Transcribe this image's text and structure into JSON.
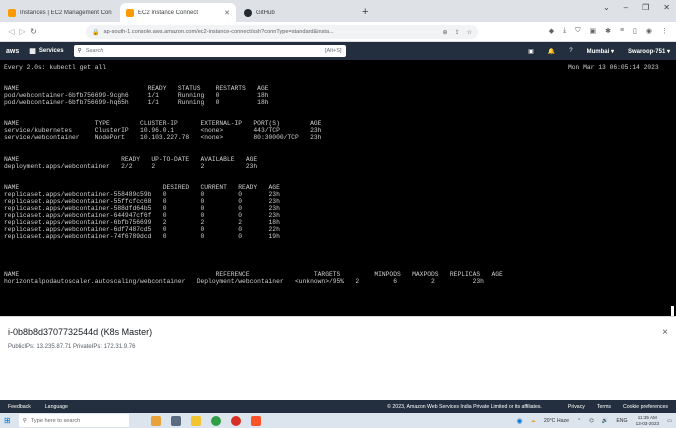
{
  "colors": {
    "aws_nav": "#232f3e",
    "terminal_bg": "#000000",
    "terminal_fg": "#d0d0d0",
    "ec2_favicon": "#ff9900",
    "edge_accent": "#0078d4"
  },
  "browser": {
    "tabs": [
      {
        "label": "Instances | EC2 Management Console",
        "icon": "aws-favicon",
        "active": false
      },
      {
        "label": "EC2 Instance Connect",
        "icon": "aws-favicon",
        "active": true
      },
      {
        "label": "GitHub",
        "icon": "github-icon",
        "active": false
      }
    ],
    "new_tab": "+",
    "url": "ap-south-1.console.aws.amazon.com/ec2-instance-connect/ssh?connType=standard&insta..."
  },
  "aws": {
    "logo": "aws",
    "services": "Services",
    "search_placeholder": "Search",
    "search_hint": "[Alt+S]",
    "region": "Mumbai ▾",
    "user": "Swaroop-751 ▾"
  },
  "terminal": {
    "lines": [
      "Every 2.0s: kubectl get all",
      "Mon Mar 13 06:05:14 2023",
      "NAME                                  READY   STATUS    RESTARTS   AGE",
      "pod/webcontainer-6bfb756699-9cgh6     1/1     Running   0          18h",
      "pod/webcontainer-6bfb756699-hq65h     1/1     Running   0          18h",
      "NAME                    TYPE        CLUSTER-IP      EXTERNAL-IP   PORT(S)        AGE",
      "service/kubernetes      ClusterIP   10.96.0.1       <none>        443/TCP        23h",
      "service/webcontainer    NodePort    10.103.227.78   <none>        80:30000/TCP   23h",
      "NAME                           READY   UP-TO-DATE   AVAILABLE   AGE",
      "deployment.apps/webcontainer   2/2     2            2           23h",
      "NAME                                      DESIRED   CURRENT   READY   AGE",
      "replicaset.apps/webcontainer-558489c59b   0         0         0       23h",
      "replicaset.apps/webcontainer-55ffcfcc68   0         0         0       23h",
      "replicaset.apps/webcontainer-588dfd64b5   0         0         0       23h",
      "replicaset.apps/webcontainer-644947cf6f   0         0         0       23h",
      "replicaset.apps/webcontainer-6bfb756699   2         2         2       18h",
      "replicaset.apps/webcontainer-6df7487cd5   0         0         0       22h",
      "replicaset.apps/webcontainer-74f6789dcd   0         0         0       19h",
      "NAME                                                    REFERENCE                 TARGETS         MINPODS   MAXPODS   REPLICAS   AGE",
      "horizontalpodautoscaler.autoscaling/webcontainer   Deployment/webcontainer   <unknown>/95%   2         6         2          23h"
    ]
  },
  "instance": {
    "title": "i-0b8b8d3707732544d (K8s Master)",
    "ips": "PublicIPs: 13.235.87.71   PrivateIPs: 172.31.9.76",
    "close": "×"
  },
  "footer": {
    "feedback": "Feedback",
    "language": "Language",
    "copyright": "© 2023, Amazon Web Services India Private Limited or its affiliates.",
    "privacy": "Privacy",
    "terms": "Terms",
    "cookies": "Cookie preferences"
  },
  "taskbar": {
    "search_placeholder": "Type here to search",
    "weather": "20°C  Haze",
    "lang": "ENG",
    "time": "11:35 AM",
    "date": "13-03-2023"
  }
}
